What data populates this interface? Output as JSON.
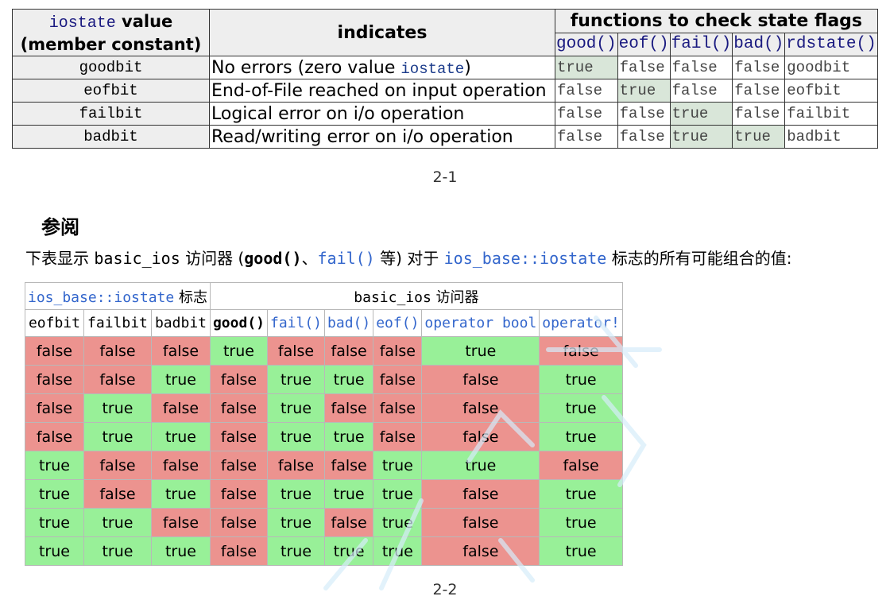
{
  "table1": {
    "header": {
      "col1_code": "iostate",
      "col1_word": "value",
      "col1_sub": "(member constant)",
      "col2": "indicates",
      "col3": "functions to check state flags",
      "functions": [
        "good()",
        "eof()",
        "fail()",
        "bad()",
        "rdstate()"
      ]
    },
    "rows": [
      {
        "name": "goodbit",
        "desc_pre": "No errors (zero value ",
        "desc_code": "iostate",
        "desc_post": ")",
        "vals": [
          "true",
          "false",
          "false",
          "false",
          "goodbit"
        ],
        "on": [
          true,
          false,
          false,
          false,
          false
        ]
      },
      {
        "name": "eofbit",
        "desc_pre": "End-of-File reached on input operation",
        "desc_code": "",
        "desc_post": "",
        "vals": [
          "false",
          "true",
          "false",
          "false",
          "eofbit"
        ],
        "on": [
          false,
          true,
          false,
          false,
          false
        ]
      },
      {
        "name": "failbit",
        "desc_pre": "Logical error on i/o operation",
        "desc_code": "",
        "desc_post": "",
        "vals": [
          "false",
          "false",
          "true",
          "false",
          "failbit"
        ],
        "on": [
          false,
          false,
          true,
          false,
          false
        ]
      },
      {
        "name": "badbit",
        "desc_pre": "Read/writing error on i/o operation",
        "desc_code": "",
        "desc_post": "",
        "vals": [
          "false",
          "false",
          "true",
          "true",
          "badbit"
        ],
        "on": [
          false,
          false,
          true,
          true,
          false
        ]
      }
    ],
    "caption": "2-1"
  },
  "section": {
    "heading": "参阅",
    "intro": {
      "p1": "下表显示 ",
      "code1": "basic_ios",
      "p2": " 访问器 (",
      "good": "good()",
      "p3": "、",
      "fail": "fail()",
      "p4": " 等) 对于 ",
      "iostate": "ios_base::iostate",
      "p5": " 标志的所有可能组合的值:"
    }
  },
  "table2": {
    "group1_code": "ios_base::iostate",
    "group1_text": " 标志",
    "group2_code": "basic_ios",
    "group2_text": " 访问器",
    "columns": [
      "eofbit",
      "failbit",
      "badbit",
      "good()",
      "fail()",
      "bad()",
      "eof()",
      "operator bool",
      "operator!"
    ],
    "rows": [
      [
        "false",
        "false",
        "false",
        "true",
        "false",
        "false",
        "false",
        "true",
        "false"
      ],
      [
        "false",
        "false",
        "true",
        "false",
        "true",
        "true",
        "false",
        "false",
        "true"
      ],
      [
        "false",
        "true",
        "false",
        "false",
        "true",
        "false",
        "false",
        "false",
        "true"
      ],
      [
        "false",
        "true",
        "true",
        "false",
        "true",
        "true",
        "false",
        "false",
        "true"
      ],
      [
        "true",
        "false",
        "false",
        "false",
        "false",
        "false",
        "true",
        "true",
        "false"
      ],
      [
        "true",
        "false",
        "true",
        "false",
        "true",
        "true",
        "true",
        "false",
        "true"
      ],
      [
        "true",
        "true",
        "false",
        "false",
        "true",
        "false",
        "true",
        "false",
        "true"
      ],
      [
        "true",
        "true",
        "true",
        "false",
        "true",
        "true",
        "true",
        "false",
        "true"
      ]
    ],
    "caption": "2-2"
  },
  "colors": {
    "true_cell": "#98f098",
    "false_cell": "#ec938f",
    "flag_on": "#d9e6d9",
    "link": "#3366cc"
  }
}
